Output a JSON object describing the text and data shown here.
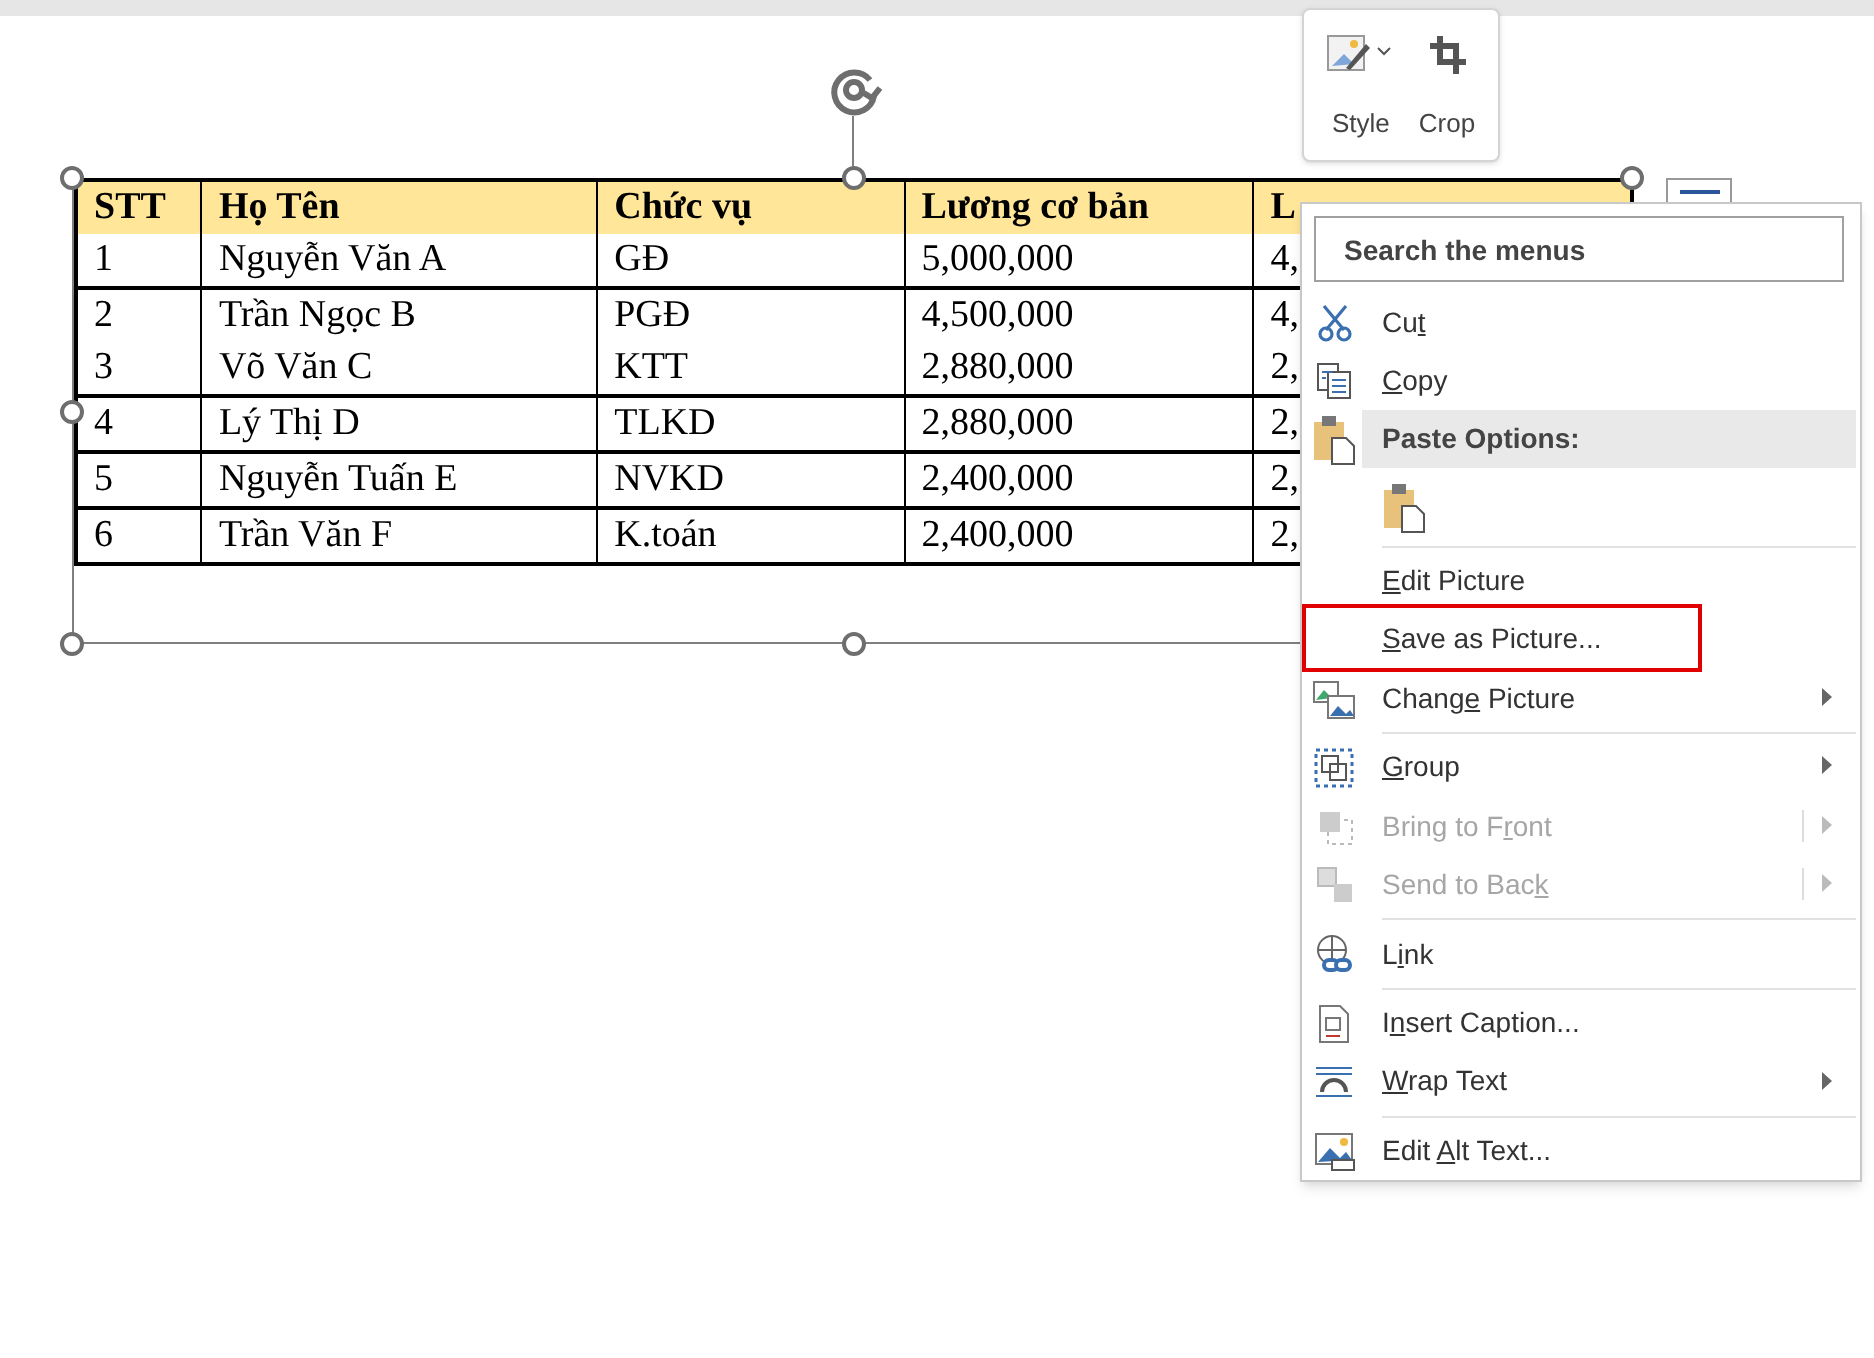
{
  "table": {
    "columns": [
      "STT",
      "Họ Tên",
      "Chức vụ",
      "Lương cơ bản",
      "L"
    ],
    "rows": [
      {
        "cells": [
          "1",
          "Nguyễn Văn A",
          "GĐ",
          "5,000,000",
          "4,"
        ],
        "border_below": true
      },
      {
        "cells": [
          "2",
          "Trần Ngọc B",
          "PGĐ",
          "4,500,000",
          "4,"
        ],
        "border_below": false
      },
      {
        "cells": [
          "3",
          "Võ Văn C",
          "KTT",
          "2,880,000",
          "2,"
        ],
        "border_below": true
      },
      {
        "cells": [
          "4",
          "Lý Thị D",
          "TLKD",
          "2,880,000",
          "2,"
        ],
        "border_below": true
      },
      {
        "cells": [
          "5",
          "Nguyễn Tuấn E",
          "NVKD",
          "2,400,000",
          "2,"
        ],
        "border_below": true
      },
      {
        "cells": [
          "6",
          "Trần Văn F",
          "K.toán",
          "2,400,000",
          "2,"
        ],
        "border_below": true
      }
    ]
  },
  "mini_toolbar": {
    "buttons": [
      {
        "label": "Style"
      },
      {
        "label": "Crop"
      }
    ]
  },
  "context_menu": {
    "items": [
      {
        "kind": "search",
        "placeholder": "Search the menus"
      },
      {
        "kind": "command",
        "before": "Cu",
        "key": "t",
        "disabled": false,
        "submenu": false,
        "outlined": false
      },
      {
        "kind": "command",
        "key": "C",
        "after": "opy",
        "disabled": false,
        "submenu": false,
        "outlined": false
      },
      {
        "kind": "header",
        "label": "Paste Options:"
      },
      {
        "kind": "paste-option"
      },
      {
        "kind": "separator"
      },
      {
        "kind": "command",
        "key": "E",
        "after": "dit Picture",
        "disabled": false,
        "submenu": false,
        "outlined": false
      },
      {
        "kind": "command",
        "key": "S",
        "after": "ave as Picture...",
        "disabled": false,
        "submenu": false,
        "outlined": true
      },
      {
        "kind": "command",
        "before": "Chang",
        "key": "e",
        "after": " Picture",
        "disabled": false,
        "submenu": true,
        "outlined": false
      },
      {
        "kind": "separator"
      },
      {
        "kind": "command",
        "key": "G",
        "after": "roup",
        "disabled": false,
        "submenu": true,
        "outlined": false
      },
      {
        "kind": "command",
        "before": "Bring to F",
        "key": "r",
        "after": "ont",
        "disabled": true,
        "submenu": true,
        "outlined": false
      },
      {
        "kind": "command",
        "before": "Send to Bac",
        "key": "k",
        "disabled": true,
        "submenu": true,
        "outlined": false
      },
      {
        "kind": "separator"
      },
      {
        "kind": "command",
        "before": "L",
        "key": "i",
        "after": "nk",
        "disabled": false,
        "submenu": false,
        "outlined": false
      },
      {
        "kind": "separator"
      },
      {
        "kind": "command",
        "before": "I",
        "key": "n",
        "after": "sert Caption...",
        "disabled": false,
        "submenu": false,
        "outlined": false
      },
      {
        "kind": "command",
        "key": "W",
        "after": "rap Text",
        "disabled": false,
        "submenu": true,
        "outlined": false
      },
      {
        "kind": "separator"
      },
      {
        "kind": "command",
        "before": "Edit ",
        "key": "A",
        "after": "lt Text...",
        "disabled": false,
        "submenu": false,
        "outlined": false
      }
    ]
  }
}
